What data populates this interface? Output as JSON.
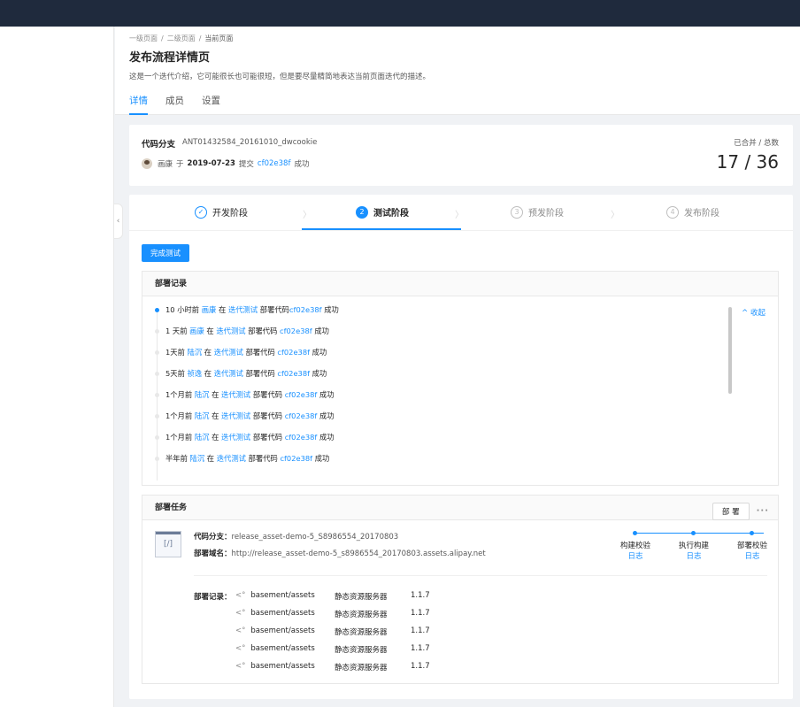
{
  "header": {
    "breadcrumb": [
      "一级页面",
      "二级页面",
      "当前页面"
    ],
    "title": "发布流程详情页",
    "description": "这是一个迭代介绍，它可能很长也可能很短，但是要尽量精简地表达当前页面迭代的描述。",
    "tabs": [
      {
        "label": "详情",
        "active": true
      },
      {
        "label": "成员",
        "active": false
      },
      {
        "label": "设置",
        "active": false
      }
    ]
  },
  "info": {
    "branch_label": "代码分支",
    "branch_value": "ANT01432584_20161010_dwcookie",
    "author": "画康",
    "at_word": "于",
    "date": "2019-07-23",
    "submit_word": "提交",
    "commit": "cf02e38f",
    "status": "成功",
    "stat_label": "已合并 / 总数",
    "stat_value": "17 / 36"
  },
  "steps": [
    {
      "index": "✓",
      "label": "开发阶段",
      "state": "done"
    },
    {
      "index": "2",
      "label": "测试阶段",
      "state": "current"
    },
    {
      "index": "3",
      "label": "预发阶段",
      "state": "waiting"
    },
    {
      "index": "4",
      "label": "发布阶段",
      "state": "waiting"
    }
  ],
  "complete_button": "完成测试",
  "deploy_log": {
    "title": "部署记录",
    "collapse_label": "^ 收起",
    "items": [
      {
        "time": "10 小时前",
        "user": "画康",
        "in": "在",
        "project": "迭代测试",
        "action": "部署代码",
        "commit": "cf02e38f",
        "status": "成功"
      },
      {
        "time": "1 天前",
        "user": "画康",
        "in": "在",
        "project": "迭代测试",
        "action": "部署代码",
        "commit": "cf02e38f",
        "status": "成功"
      },
      {
        "time": "1天前",
        "user": "陆沉",
        "in": "在",
        "project": "迭代测试",
        "action": "部署代码",
        "commit": "cf02e38f",
        "status": "成功"
      },
      {
        "time": "5天前",
        "user": "祯逸",
        "in": "在",
        "project": "迭代测试",
        "action": "部署代码",
        "commit": "cf02e38f",
        "status": "成功"
      },
      {
        "time": "1个月前",
        "user": "陆沉",
        "in": "在",
        "project": "迭代测试",
        "action": "部署代码",
        "commit": "cf02e38f",
        "status": "成功"
      },
      {
        "time": "1个月前",
        "user": "陆沉",
        "in": "在",
        "project": "迭代测试",
        "action": "部署代码",
        "commit": "cf02e38f",
        "status": "成功"
      },
      {
        "time": "1个月前",
        "user": "陆沉",
        "in": "在",
        "project": "迭代测试",
        "action": "部署代码",
        "commit": "cf02e38f",
        "status": "成功"
      },
      {
        "time": "半年前",
        "user": "陆沉",
        "in": "在",
        "project": "迭代测试",
        "action": "部署代码",
        "commit": "cf02e38f",
        "status": "成功"
      }
    ]
  },
  "deploy_task": {
    "title": "部署任务",
    "deploy_button": "部 署",
    "more": "···",
    "icon_text": "[/]",
    "branch_label": "代码分支：",
    "branch_value": "release_asset-demo-5_S8986554_20170803",
    "domain_label": "部署域名：",
    "domain_value": "http://release_asset-demo-5_s8986554_20170803.assets.alipay.net",
    "pipeline": [
      {
        "label": "构建校验",
        "log": "日志"
      },
      {
        "label": "执行构建",
        "log": "日志"
      },
      {
        "label": "部署校验",
        "log": "日志"
      }
    ],
    "records_label": "部署记录：",
    "records": [
      {
        "path": "basement/assets",
        "server": "静态资源服务器",
        "version": "1.1.7"
      },
      {
        "path": "basement/assets",
        "server": "静态资源服务器",
        "version": "1.1.7"
      },
      {
        "path": "basement/assets",
        "server": "静态资源服务器",
        "version": "1.1.7"
      },
      {
        "path": "basement/assets",
        "server": "静态资源服务器",
        "version": "1.1.7"
      },
      {
        "path": "basement/assets",
        "server": "静态资源服务器",
        "version": "1.1.7"
      }
    ]
  },
  "colors": {
    "primary": "#1890ff",
    "topbar": "#1f2a3d",
    "background": "#f0f2f5"
  }
}
